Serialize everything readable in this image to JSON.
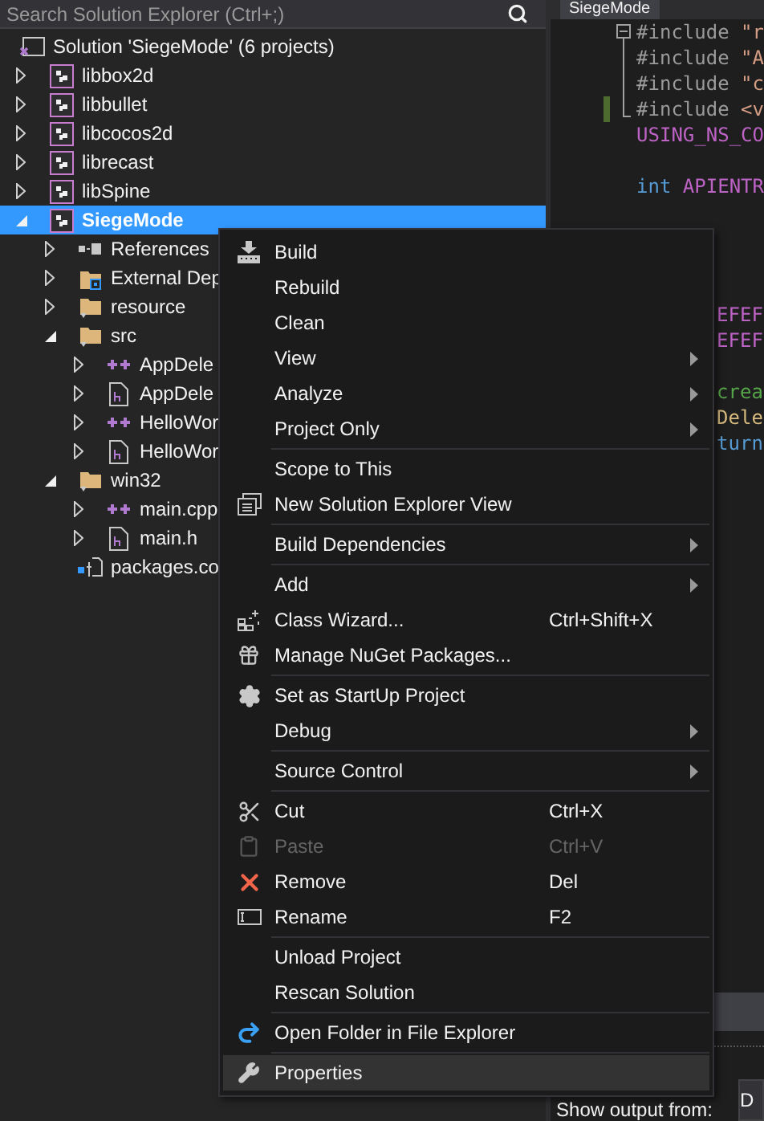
{
  "solution_explorer": {
    "search": {
      "placeholder": "Search Solution Explorer (Ctrl+;)"
    },
    "tree": [
      {
        "label": "Solution 'SiegeMode' (6 projects)",
        "kind": "solution",
        "selected": false,
        "children": [
          {
            "label": "libbox2d",
            "kind": "project",
            "selected": false,
            "expanded": false
          },
          {
            "label": "libbullet",
            "kind": "project",
            "selected": false,
            "expanded": false
          },
          {
            "label": "libcocos2d",
            "kind": "project",
            "selected": false,
            "expanded": false
          },
          {
            "label": "librecast",
            "kind": "project",
            "selected": false,
            "expanded": false
          },
          {
            "label": "libSpine",
            "kind": "project",
            "selected": false,
            "expanded": false
          },
          {
            "label": "SiegeMode",
            "kind": "project",
            "selected": true,
            "expanded": true,
            "children": [
              {
                "label": "References",
                "kind": "references",
                "selected": false,
                "expanded": false
              },
              {
                "label": "External Dep",
                "kind": "external",
                "selected": false,
                "expanded": false
              },
              {
                "label": "resource",
                "kind": "filter",
                "selected": false,
                "expanded": false
              },
              {
                "label": "src",
                "kind": "filter",
                "selected": false,
                "expanded": true,
                "children": [
                  {
                    "label": "AppDele",
                    "kind": "cpp",
                    "selected": false,
                    "expanded": false
                  },
                  {
                    "label": "AppDele",
                    "kind": "header",
                    "selected": false,
                    "expanded": false
                  },
                  {
                    "label": "HelloWor",
                    "kind": "cpp",
                    "selected": false,
                    "expanded": false
                  },
                  {
                    "label": "HelloWor",
                    "kind": "header",
                    "selected": false,
                    "expanded": false
                  }
                ]
              },
              {
                "label": "win32",
                "kind": "filter",
                "selected": false,
                "expanded": true,
                "children": [
                  {
                    "label": "main.cpp",
                    "kind": "cpp",
                    "selected": false,
                    "expanded": false
                  },
                  {
                    "label": "main.h",
                    "kind": "header",
                    "selected": false,
                    "expanded": false
                  }
                ]
              },
              {
                "label": "packages.co",
                "kind": "config",
                "selected": false
              }
            ]
          }
        ]
      }
    ]
  },
  "editor": {
    "tab": {
      "title": "SiegeMode"
    },
    "lines": [
      {
        "kind": "code",
        "modified": false,
        "expanded": true,
        "tokens": [
          {
            "kind": "directive",
            "text": "#include "
          },
          {
            "kind": "string",
            "text": "\"r"
          }
        ],
        "children": [
          {
            "kind": "code",
            "modified": false,
            "tokens": [
              {
                "kind": "directive",
                "text": "#include "
              },
              {
                "kind": "string",
                "text": "\"A"
              }
            ]
          },
          {
            "kind": "code",
            "modified": false,
            "tokens": [
              {
                "kind": "directive",
                "text": "#include "
              },
              {
                "kind": "string",
                "text": "\"c"
              }
            ]
          },
          {
            "kind": "code",
            "modified": true,
            "tokens": [
              {
                "kind": "directive",
                "text": "#include "
              },
              {
                "kind": "string",
                "text": "<v"
              }
            ]
          }
        ]
      },
      {
        "kind": "code",
        "modified": false,
        "tokens": [
          {
            "kind": "macro",
            "text": "USING_NS_CO"
          }
        ]
      },
      {
        "kind": "blank",
        "modified": false
      },
      {
        "kind": "code",
        "modified": false,
        "tokens": [
          {
            "kind": "keyword",
            "text": "int "
          },
          {
            "kind": "macro",
            "text": "APIENTR"
          }
        ]
      },
      {
        "kind": "blank",
        "modified": false
      },
      {
        "kind": "blank",
        "modified": false
      },
      {
        "kind": "blank",
        "modified": false
      },
      {
        "kind": "blank",
        "modified": false
      },
      {
        "kind": "tail",
        "modified": false,
        "tokens": [
          {
            "kind": "macro",
            "text": "EFEF"
          }
        ]
      },
      {
        "kind": "tail",
        "modified": false,
        "tokens": [
          {
            "kind": "macro",
            "text": "EFEF"
          }
        ]
      },
      {
        "kind": "blank",
        "modified": false
      },
      {
        "kind": "tail",
        "modified": false,
        "tokens": [
          {
            "kind": "comment",
            "text": "crea"
          }
        ]
      },
      {
        "kind": "tail",
        "modified": false,
        "tokens": [
          {
            "kind": "function",
            "text": "Dele"
          }
        ]
      },
      {
        "kind": "tail",
        "modified": false,
        "tokens": [
          {
            "kind": "keyword",
            "text": "turn"
          }
        ]
      }
    ]
  },
  "output": {
    "label": "Show output from:",
    "source": "D"
  },
  "context_menu": {
    "items": [
      {
        "kind": "item",
        "label": "Build",
        "submenu": false,
        "disabled": false,
        "selected": false
      },
      {
        "kind": "item",
        "label": "Rebuild",
        "submenu": false,
        "disabled": false,
        "selected": false
      },
      {
        "kind": "item",
        "label": "Clean",
        "submenu": false,
        "disabled": false,
        "selected": false
      },
      {
        "kind": "item",
        "label": "View",
        "submenu": true,
        "disabled": false,
        "selected": false
      },
      {
        "kind": "item",
        "label": "Analyze",
        "submenu": true,
        "disabled": false,
        "selected": false
      },
      {
        "kind": "item",
        "label": "Project Only",
        "submenu": true,
        "disabled": false,
        "selected": false
      },
      {
        "kind": "separator"
      },
      {
        "kind": "item",
        "label": "Scope to This",
        "submenu": false,
        "disabled": false,
        "selected": false
      },
      {
        "kind": "item",
        "label": "New Solution Explorer View",
        "submenu": false,
        "disabled": false,
        "selected": false
      },
      {
        "kind": "separator"
      },
      {
        "kind": "item",
        "label": "Build Dependencies",
        "submenu": true,
        "disabled": false,
        "selected": false
      },
      {
        "kind": "separator"
      },
      {
        "kind": "item",
        "label": "Add",
        "submenu": true,
        "disabled": false,
        "selected": false
      },
      {
        "kind": "item",
        "label": "Class Wizard...",
        "shortcut": "Ctrl+Shift+X",
        "submenu": false,
        "disabled": false,
        "selected": false
      },
      {
        "kind": "item",
        "label": "Manage NuGet Packages...",
        "submenu": false,
        "disabled": false,
        "selected": false
      },
      {
        "kind": "separator"
      },
      {
        "kind": "item",
        "label": "Set as StartUp Project",
        "submenu": false,
        "disabled": false,
        "selected": false
      },
      {
        "kind": "item",
        "label": "Debug",
        "submenu": true,
        "disabled": false,
        "selected": false
      },
      {
        "kind": "separator"
      },
      {
        "kind": "item",
        "label": "Source Control",
        "submenu": true,
        "disabled": false,
        "selected": false
      },
      {
        "kind": "separator"
      },
      {
        "kind": "item",
        "label": "Cut",
        "shortcut": "Ctrl+X",
        "submenu": false,
        "disabled": false,
        "selected": false
      },
      {
        "kind": "item",
        "label": "Paste",
        "shortcut": "Ctrl+V",
        "submenu": false,
        "disabled": true,
        "selected": false
      },
      {
        "kind": "item",
        "label": "Remove",
        "shortcut": "Del",
        "submenu": false,
        "disabled": false,
        "selected": false
      },
      {
        "kind": "item",
        "label": "Rename",
        "shortcut": "F2",
        "submenu": false,
        "disabled": false,
        "selected": false
      },
      {
        "kind": "separator"
      },
      {
        "kind": "item",
        "label": "Unload Project",
        "submenu": false,
        "disabled": false,
        "selected": false
      },
      {
        "kind": "item",
        "label": "Rescan Solution",
        "submenu": false,
        "disabled": false,
        "selected": false
      },
      {
        "kind": "separator"
      },
      {
        "kind": "item",
        "label": "Open Folder in File Explorer",
        "submenu": false,
        "disabled": false,
        "selected": false
      },
      {
        "kind": "separator"
      },
      {
        "kind": "item",
        "label": "Properties",
        "submenu": false,
        "disabled": false,
        "selected": true
      }
    ]
  }
}
